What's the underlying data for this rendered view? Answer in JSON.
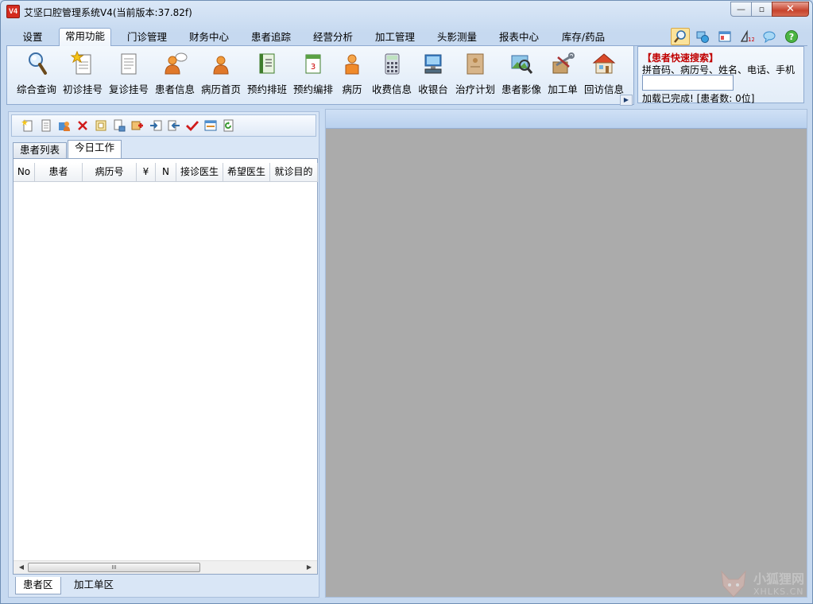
{
  "window": {
    "app_icon_text": "V4",
    "title": "艾坚口腔管理系统V4(当前版本:37.82f)",
    "minimize": "—",
    "maximize": "▫",
    "close": "✕"
  },
  "menu": {
    "tabs": [
      "设置",
      "常用功能",
      "门诊管理",
      "财务中心",
      "患者追踪",
      "经营分析",
      "加工管理",
      "头影测量",
      "报表中心",
      "库存/药品"
    ],
    "active_index": 1,
    "right_icons": [
      "search-icon",
      "network-icon",
      "window-icon",
      "calculator-icon",
      "chat-icon",
      "help-icon"
    ]
  },
  "ribbon": {
    "items": [
      {
        "label": "综合查询",
        "icon": "magnifier-icon"
      },
      {
        "label": "初诊挂号",
        "icon": "new-document-star-icon"
      },
      {
        "label": "复诊挂号",
        "icon": "document-icon"
      },
      {
        "label": "患者信息",
        "icon": "person-speech-icon"
      },
      {
        "label": "病历首页",
        "icon": "person-icon"
      },
      {
        "label": "预约排班",
        "icon": "schedule-book-icon"
      },
      {
        "label": "预约编排",
        "icon": "calendar-icon"
      },
      {
        "label": "病历",
        "icon": "person-orange-icon"
      },
      {
        "label": "收费信息",
        "icon": "calculator-icon"
      },
      {
        "label": "收银台",
        "icon": "cashier-computer-icon"
      },
      {
        "label": "治疗计划",
        "icon": "envelope-file-icon"
      },
      {
        "label": "患者影像",
        "icon": "image-magnifier-icon"
      },
      {
        "label": "加工单",
        "icon": "tools-icon"
      },
      {
        "label": "回访信息",
        "icon": "house-icon"
      }
    ],
    "scroll_arrow": "▶"
  },
  "search_panel": {
    "title": "【患者快速搜索】",
    "hint": "拼音码、病历号、姓名、电话、手机",
    "input_value": "",
    "status": "加载已完成! [患者数: 0位]"
  },
  "left_toolbar": {
    "icons": [
      "new-icon",
      "document-icon",
      "edit-person-icon",
      "delete-icon",
      "report-icon",
      "list-icon",
      "add-icon",
      "import-icon",
      "export-icon",
      "check-icon",
      "window-icon",
      "refresh-icon"
    ]
  },
  "inner_tabs": [
    "患者列表",
    "今日工作"
  ],
  "inner_active_index": 1,
  "grid": {
    "columns": [
      "No",
      "患者",
      "病历号",
      "¥",
      "N",
      "接诊医生",
      "希望医生",
      "就诊目的"
    ]
  },
  "scrollbar": {
    "left": "◀",
    "right": "▶",
    "grip": "III"
  },
  "bottom_tabs": [
    "患者区",
    "加工单区"
  ],
  "bottom_active_index": 0,
  "watermark": {
    "text": "小狐狸网",
    "sub": "XHLKS.CN"
  }
}
